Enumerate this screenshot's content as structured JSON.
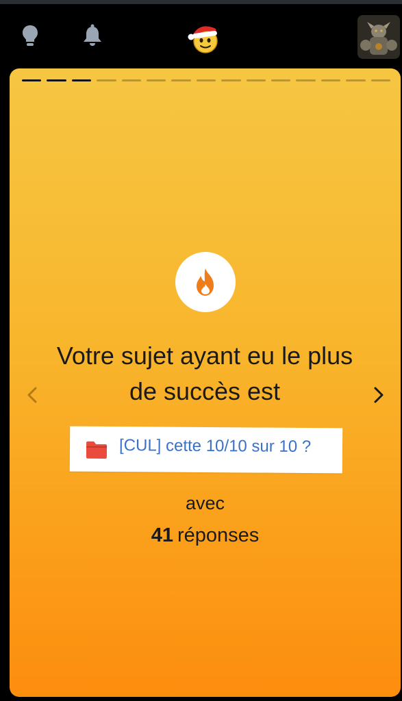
{
  "nav": {
    "icons": [
      "lightbulb-icon",
      "bell-icon",
      "santa-smiley-logo",
      "knight-avatar"
    ]
  },
  "story": {
    "progress_total": 15,
    "progress_done": 3,
    "icon": "flame-icon",
    "headline": "Votre sujet ayant eu le plus de succès est",
    "topic": {
      "icon": "folder-icon",
      "title": "[CUL] cette 10/10 sur 10 ?"
    },
    "with_label": "avec",
    "reply_count": "41",
    "reply_label": "réponses"
  },
  "colors": {
    "card_top": "#f6c642",
    "card_bottom": "#fd8d0e",
    "link_blue": "#3b71c9",
    "folder_red": "#e94b3c",
    "flame_orange": "#f07d1c"
  }
}
